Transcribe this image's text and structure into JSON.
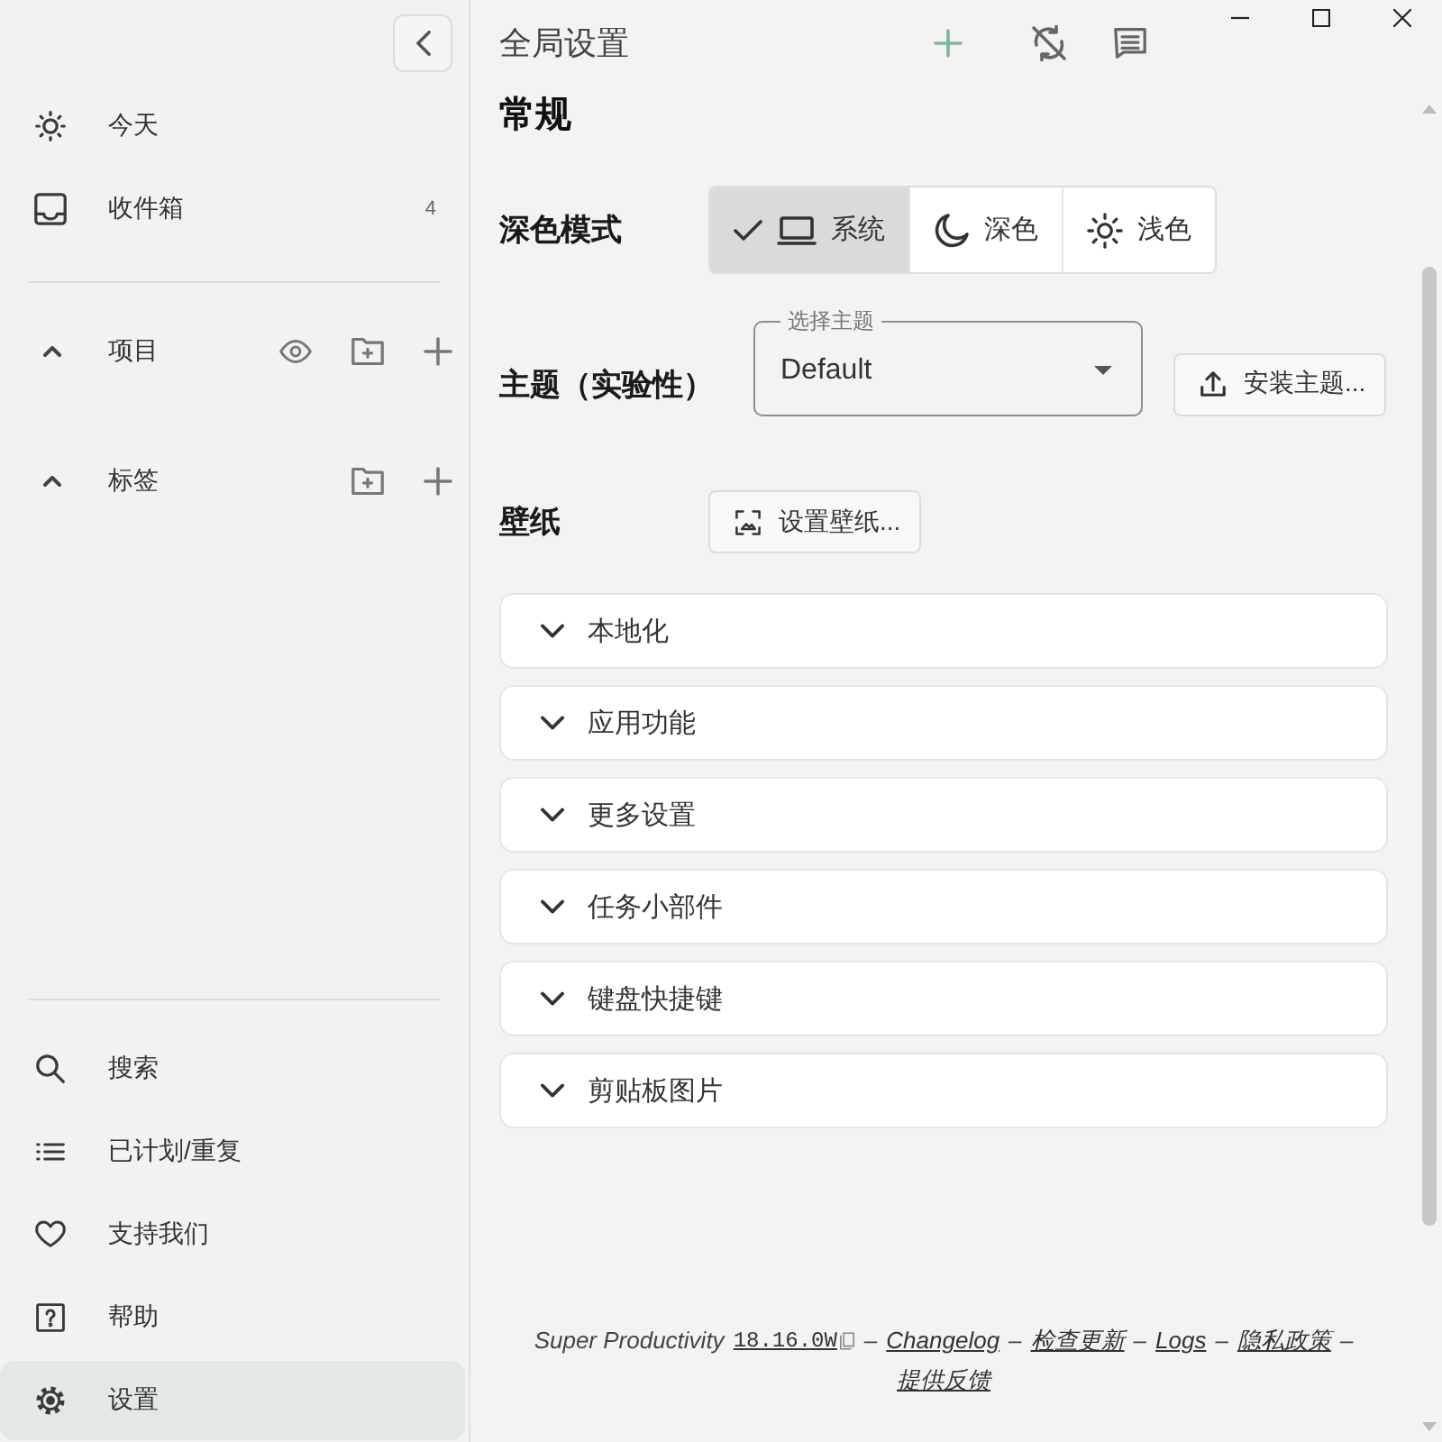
{
  "sidebar": {
    "top_items": [
      {
        "kind": "today",
        "label": "今天",
        "selected": false
      },
      {
        "kind": "inbox",
        "label": "收件箱",
        "count": "4",
        "selected": false
      }
    ],
    "sections": [
      {
        "kind": "projects",
        "label": "项目",
        "expanded": true
      },
      {
        "kind": "tags",
        "label": "标签",
        "expanded": true
      }
    ],
    "bottom_items": [
      {
        "kind": "search",
        "label": "搜索",
        "selected": false
      },
      {
        "kind": "scheduled",
        "label": "已计划/重复",
        "selected": false
      },
      {
        "kind": "donate",
        "label": "支持我们",
        "selected": false
      },
      {
        "kind": "help",
        "label": "帮助",
        "selected": false
      },
      {
        "kind": "settings",
        "label": "设置",
        "selected": true
      }
    ]
  },
  "header": {
    "title": "全局设置"
  },
  "settings": {
    "heading": "常规",
    "dark_mode": {
      "label": "深色模式",
      "options": [
        {
          "kind": "system",
          "label": "系统",
          "selected": true
        },
        {
          "kind": "dark",
          "label": "深色",
          "selected": false
        },
        {
          "kind": "light",
          "label": "浅色",
          "selected": false
        }
      ]
    },
    "theme": {
      "label": "主题（实验性）",
      "select_label": "选择主题",
      "value": "Default",
      "install_button": "安装主题..."
    },
    "wallpaper": {
      "label": "壁纸",
      "button": "设置壁纸..."
    },
    "panels": [
      {
        "label": "本地化",
        "expanded": false
      },
      {
        "label": "应用功能",
        "expanded": false
      },
      {
        "label": "更多设置",
        "expanded": false
      },
      {
        "label": "任务小部件",
        "expanded": false
      },
      {
        "label": "键盘快捷键",
        "expanded": false
      },
      {
        "label": "剪贴板图片",
        "expanded": false
      }
    ]
  },
  "footer": {
    "app_name": "Super Productivity",
    "version": "18.16.0W",
    "items": [
      {
        "separator": "–",
        "label": "Changelog"
      },
      {
        "separator": "–",
        "label": "检查更新"
      },
      {
        "separator": "–",
        "label": "Logs"
      },
      {
        "separator": "–",
        "label": "隐私政策"
      },
      {
        "separator": "–",
        "label": "提供反馈"
      }
    ]
  }
}
